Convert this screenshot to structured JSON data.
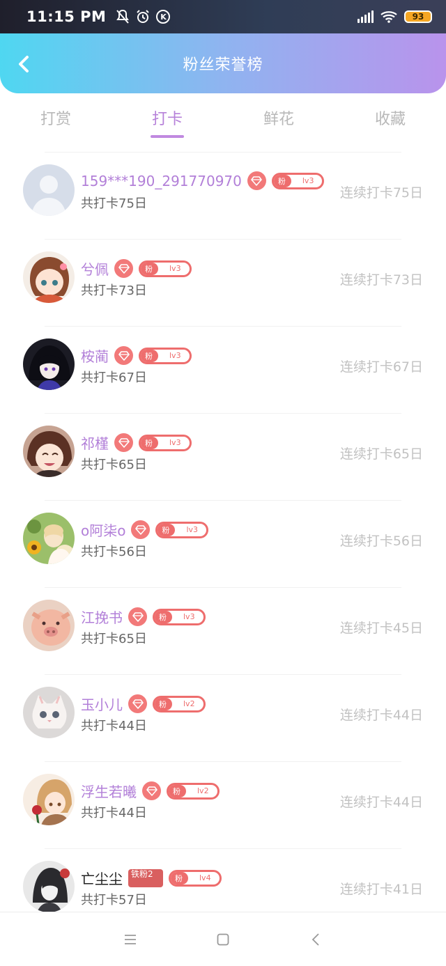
{
  "status_bar": {
    "time": "11:15 PM",
    "battery": "93",
    "icons": [
      "bell-off-icon",
      "alarm-icon",
      "k-icon"
    ]
  },
  "header": {
    "title": "粉丝荣誉榜",
    "back_icon": "chevron-left-icon"
  },
  "tabs": [
    {
      "label": "打赏",
      "active": false
    },
    {
      "label": "打卡",
      "active": true
    },
    {
      "label": "鲜花",
      "active": false
    },
    {
      "label": "收藏",
      "active": false
    }
  ],
  "colors": {
    "accent": "#b681d9",
    "badge_red": "#ee6d6d",
    "header_start": "#4fd7f1",
    "header_end": "#b993ec"
  },
  "fans": [
    {
      "name": "159***190_291770970",
      "badge_fan": "粉",
      "badge_level": "lv3",
      "total": "共打卡75日",
      "streak": "连续打卡75日",
      "avatar": "default-avatar",
      "name_dark": false,
      "iron": ""
    },
    {
      "name": "兮佩",
      "badge_fan": "粉",
      "badge_level": "lv3",
      "total": "共打卡73日",
      "streak": "连续打卡73日",
      "avatar": "anime-girl-brown",
      "name_dark": false,
      "iron": ""
    },
    {
      "name": "桉蔺",
      "badge_fan": "粉",
      "badge_level": "lv3",
      "total": "共打卡67日",
      "streak": "连续打卡67日",
      "avatar": "anime-dark",
      "name_dark": false,
      "iron": ""
    },
    {
      "name": "祁槿",
      "badge_fan": "粉",
      "badge_level": "lv3",
      "total": "共打卡65日",
      "streak": "连续打卡65日",
      "avatar": "anime-brown-hair",
      "name_dark": false,
      "iron": ""
    },
    {
      "name": "o阿柒o",
      "badge_fan": "粉",
      "badge_level": "lv3",
      "total": "共打卡56日",
      "streak": "连续打卡56日",
      "avatar": "sunflower-girl",
      "name_dark": false,
      "iron": ""
    },
    {
      "name": "江挽书",
      "badge_fan": "粉",
      "badge_level": "lv3",
      "total": "共打卡65日",
      "streak": "连续打卡45日",
      "avatar": "pig-plush",
      "name_dark": false,
      "iron": ""
    },
    {
      "name": "玉小儿",
      "badge_fan": "粉",
      "badge_level": "lv2",
      "total": "共打卡44日",
      "streak": "连续打卡44日",
      "avatar": "white-kitten",
      "name_dark": false,
      "iron": ""
    },
    {
      "name": "浮生若曦",
      "badge_fan": "粉",
      "badge_level": "lv2",
      "total": "共打卡44日",
      "streak": "连续打卡44日",
      "avatar": "anime-rose",
      "name_dark": false,
      "iron": ""
    },
    {
      "name": "亡尘尘",
      "badge_fan": "粉",
      "badge_level": "lv4",
      "total": "共打卡57日",
      "streak": "连续打卡41日",
      "avatar": "anime-bw",
      "name_dark": true,
      "iron": "铁粉2"
    }
  ],
  "nav": {
    "menu_icon": "menu-icon",
    "home_icon": "square-icon",
    "back_icon": "back-icon"
  }
}
